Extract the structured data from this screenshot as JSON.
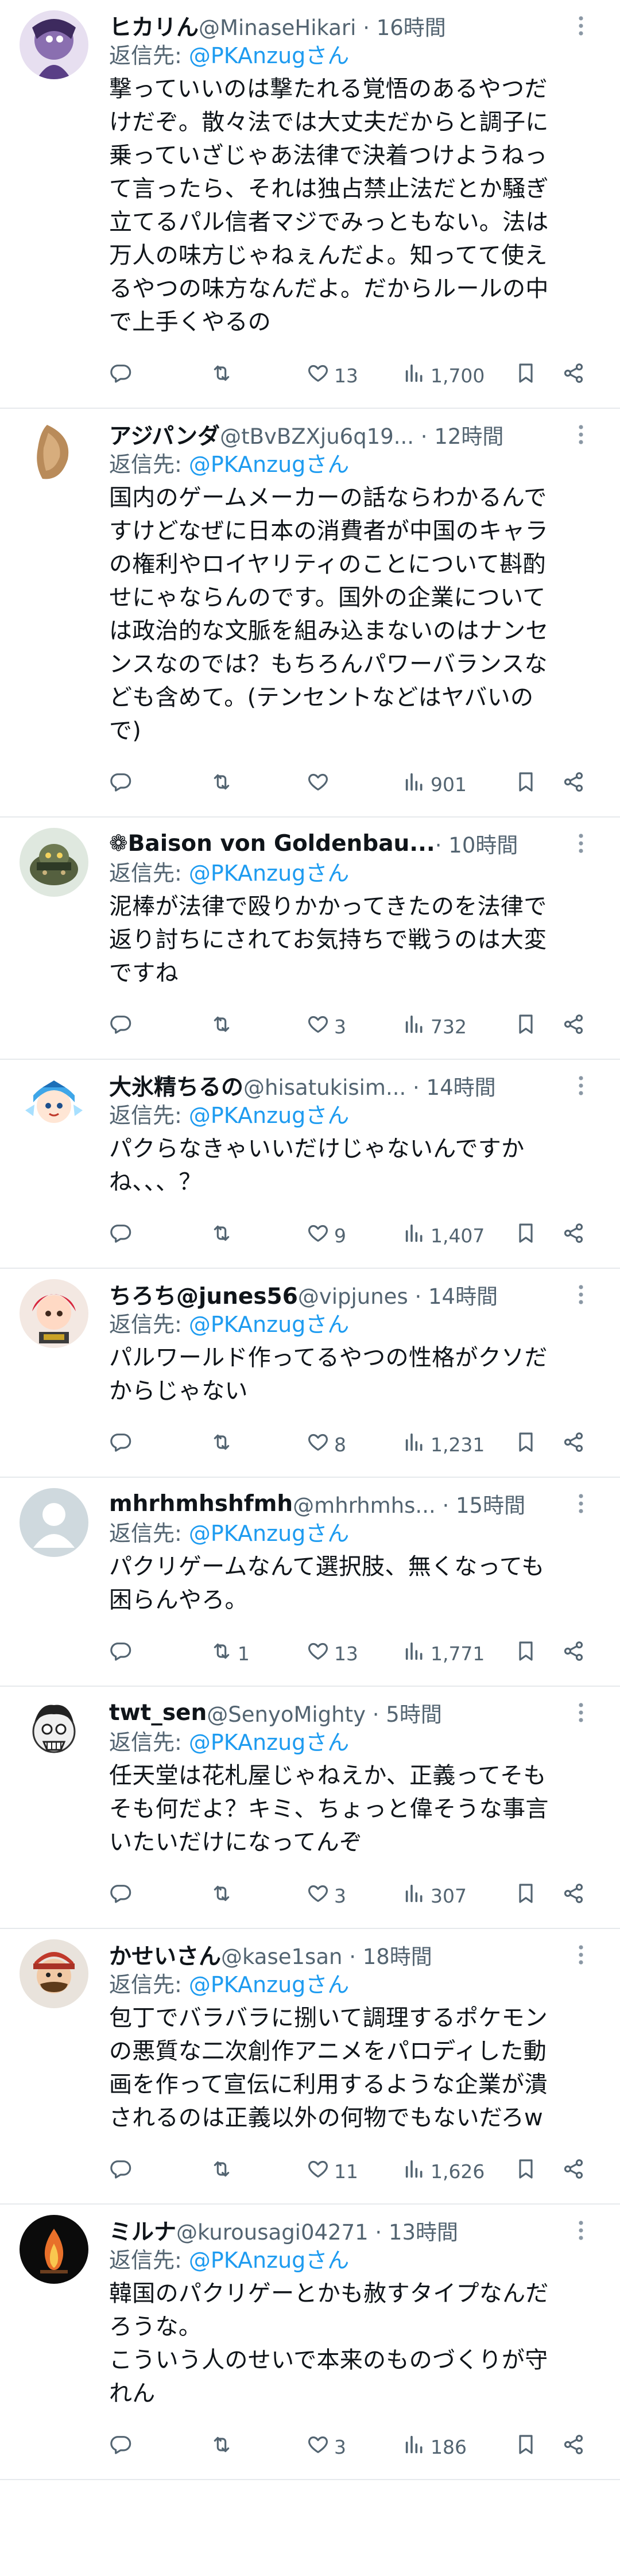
{
  "reply_prefix": "返信先: ",
  "reply_to": "@PKAnzugさん",
  "colors": {
    "text": "#0f1419",
    "secondary": "#536471",
    "link": "#1d9bf0",
    "divider": "#e6e9ec"
  },
  "icons": {
    "reply": "comment-bubble-icon",
    "retweet": "retweet-arrows-icon",
    "like": "heart-icon",
    "views": "bar-chart-icon",
    "bookmark": "bookmark-icon",
    "share": "share-icon",
    "more": "more-vertical-icon"
  },
  "posts": [
    {
      "name": "ヒカリん",
      "meta": " @MinaseHikari · 16時間",
      "lines": [
        "撃っていいのは撃たれる覚悟のあるやつだ",
        "けだぞ。散々法では大丈夫だからと調子に",
        "乗っていざじゃあ法律で決着つけようねっ",
        "て言ったら、それは独占禁止法だとか騒ぎ",
        "立てるパル信者マジでみっともない。法は",
        "万人の味方じゃねぇんだよ。知ってて使え",
        "るやつの味方なんだよ。だからルールの中",
        "で上手くやるの"
      ],
      "replies": "",
      "retweets": "",
      "likes": "13",
      "views": "1,700"
    },
    {
      "name": "アジパンダ",
      "meta": " @tBvBZXju6q19... · 12時間",
      "lines": [
        "国内のゲームメーカーの話ならわかるんで",
        "すけどなぜに日本の消費者が中国のキャラ",
        "の権利やロイヤリティのことについて斟酌",
        "せにゃならんのです。国外の企業について",
        "は政治的な文脈を組み込まないのはナンセ",
        "ンスなのでは？もちろんパワーバランスな",
        "ども含めて。(テンセントなどはヤバいの",
        "で)"
      ],
      "replies": "",
      "retweets": "",
      "likes": "",
      "views": "901"
    },
    {
      "name": "❁Baison von Goldenbau...",
      "meta": " · 10時間",
      "lines": [
        "泥棒が法律で殴りかかってきたのを法律で",
        "返り討ちにされてお気持ちで戦うのは大変",
        "ですね"
      ],
      "replies": "",
      "retweets": "",
      "likes": "3",
      "views": "732"
    },
    {
      "name": "大氷精ちるの",
      "meta": " @hisatukisim... · 14時間",
      "lines": [
        "パクらなきゃいいだけじゃないんですか",
        "ね、、、？"
      ],
      "replies": "",
      "retweets": "",
      "likes": "9",
      "views": "1,407"
    },
    {
      "name": "ちろち@junes56",
      "meta": " @vipjunes · 14時間",
      "lines": [
        "パルワールド作ってるやつの性格がクソだ",
        "からじゃない"
      ],
      "replies": "",
      "retweets": "",
      "likes": "8",
      "views": "1,231"
    },
    {
      "name": "mhrhmhshfmh",
      "meta": " @mhrhmhs... · 15時間",
      "lines": [
        "パクリゲームなんて選択肢、無くなっても",
        "困らんやろ。"
      ],
      "replies": "",
      "retweets": "1",
      "likes": "13",
      "views": "1,771"
    },
    {
      "name": "twt_sen",
      "meta": " @SenyoMighty · 5時間",
      "lines": [
        "任天堂は花札屋じゃねえか、正義ってそも",
        "そも何だよ？キミ、ちょっと偉そうな事言",
        "いたいだけになってんぞ"
      ],
      "replies": "",
      "retweets": "",
      "likes": "3",
      "views": "307"
    },
    {
      "name": "かせいさん",
      "meta": " @kase1san · 18時間",
      "lines": [
        "包丁でバラバラに捌いて調理するポケモン",
        "の悪質な二次創作アニメをパロディした動",
        "画を作って宣伝に利用するような企業が潰",
        "されるのは正義以外の何物でもないだろw"
      ],
      "replies": "",
      "retweets": "",
      "likes": "11",
      "views": "1,626"
    },
    {
      "name": "ミルナ",
      "meta": " @kurousagi04271 · 13時間",
      "lines": [
        "韓国のパクリゲーとかも赦すタイプなんだ",
        "ろうな。",
        "こういう人のせいで本来のものづくりが守",
        "れん"
      ],
      "replies": "",
      "retweets": "",
      "likes": "3",
      "views": "186"
    }
  ]
}
